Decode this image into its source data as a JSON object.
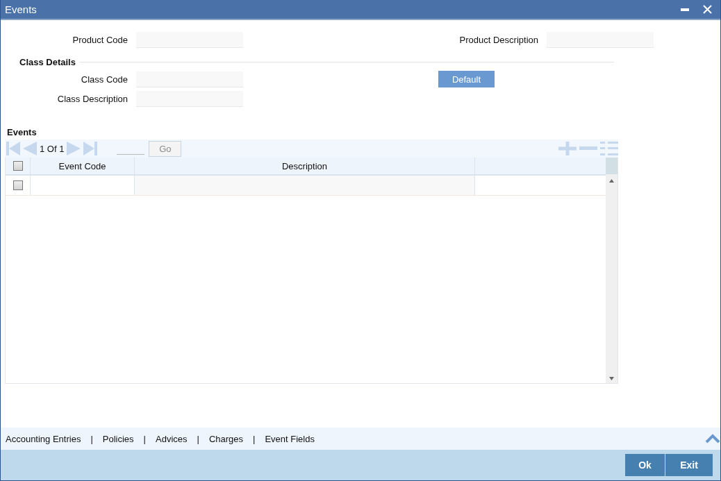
{
  "window": {
    "title": "Events"
  },
  "product": {
    "code_label": "Product Code",
    "description_label": "Product Description"
  },
  "class_details": {
    "heading": "Class Details",
    "code_label": "Class Code",
    "description_label": "Class Description",
    "default_button": "Default"
  },
  "events": {
    "heading": "Events",
    "pager": "1 Of 1",
    "go_button": "Go",
    "columns": [
      {
        "label": "Event Code"
      },
      {
        "label": "Description"
      }
    ],
    "rows": [
      {
        "checked": false
      }
    ],
    "select_all_checked": false
  },
  "footer_links": [
    "Accounting Entries",
    "Policies",
    "Advices",
    "Charges",
    "Event Fields"
  ],
  "footer_link_separator": "|",
  "buttons": [
    "Ok",
    "Exit"
  ]
}
